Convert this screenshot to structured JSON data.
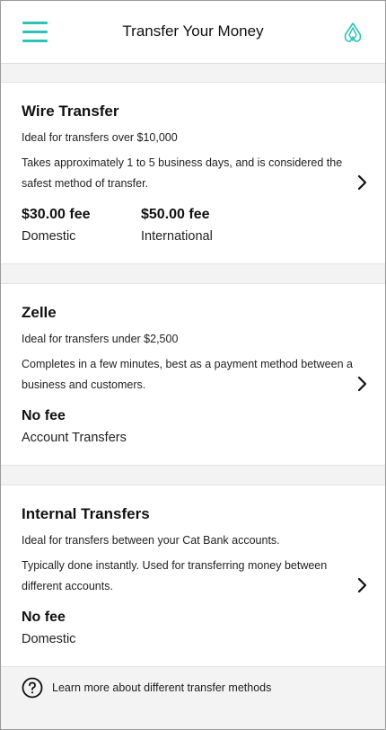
{
  "header": {
    "title": "Transfer Your Money",
    "menu_icon": "hamburger-menu-icon",
    "logo_icon": "cat-bank-logo-icon",
    "accent_color": "#2cc3b4"
  },
  "methods": [
    {
      "title": "Wire Transfer",
      "subtitle": "Ideal for transfers over $10,000",
      "description": "Takes approximately 1 to 5 business days, and is considered the safest method of transfer.",
      "fees": [
        {
          "amount": "$30.00 fee",
          "label": "Domestic"
        },
        {
          "amount": "$50.00 fee",
          "label": "International"
        }
      ]
    },
    {
      "title": "Zelle",
      "subtitle": "Ideal for transfers under $2,500",
      "description": "Completes in a few minutes, best as a payment method between a business and customers.",
      "fees": [
        {
          "amount": "No fee",
          "label": "Account Transfers"
        }
      ]
    },
    {
      "title": "Internal Transfers",
      "subtitle": "Ideal for transfers between your Cat Bank accounts.",
      "description": "Typically done instantly. Used for transferring money between different accounts.",
      "fees": [
        {
          "amount": "No fee",
          "label": "Domestic"
        }
      ]
    }
  ],
  "footer": {
    "text": "Learn more about different transfer methods",
    "icon": "help-circle-icon"
  }
}
